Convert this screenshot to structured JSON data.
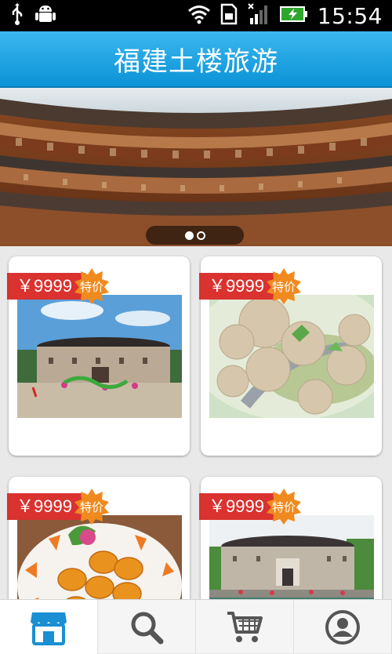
{
  "status_bar": {
    "time": "15:54",
    "icons": [
      "usb-icon",
      "android-debug-icon",
      "wifi-icon",
      "sim-icon",
      "signal-icon",
      "battery-charging-icon"
    ]
  },
  "header": {
    "title": "福建土楼旅游"
  },
  "banner": {
    "image": "tulou-courtyard-photo",
    "page_count": 2,
    "active_page": 1
  },
  "products": [
    {
      "price": "￥9999",
      "badge": "特价",
      "image": "tulou-exterior-festival-photo"
    },
    {
      "price": "￥9999",
      "badge": "特价",
      "image": "meatball-soup-photo"
    },
    {
      "price": "￥9999",
      "badge": "特价",
      "image": "fried-cakes-plate-photo"
    },
    {
      "price": "￥9999",
      "badge": "特价",
      "image": "tulou-lakeside-photo"
    }
  ],
  "bottom_nav": [
    {
      "icon": "store-icon",
      "active": true
    },
    {
      "icon": "search-icon",
      "active": false
    },
    {
      "icon": "cart-icon",
      "active": false
    },
    {
      "icon": "profile-icon",
      "active": false
    }
  ],
  "colors": {
    "header": "#1ba3e6",
    "price_tag": "#d9322f",
    "badge": "#f08a1e"
  }
}
